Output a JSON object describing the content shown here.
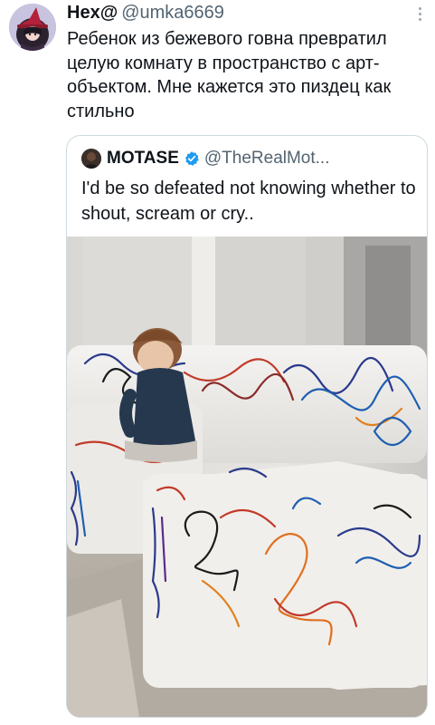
{
  "tweet": {
    "display_name": "Hex@",
    "handle": "@umka6669",
    "text": "Ребенок из бежевого говна превратил целую комнату в пространство с арт-объектом. Мне кажется это пиздец как стильно",
    "avatar_icon": "witch-avatar-icon",
    "more_icon": "more-options-icon"
  },
  "quote": {
    "display_name": "MOTASE",
    "handle": "@TheRealMot...",
    "verified_color": "#1d9bf0",
    "text": "I'd be so defeated not knowing whether to shout, scream or cry..",
    "media_icon": "photo-child-scribbled-sofa"
  },
  "colors": {
    "primary_text": "#0f1419",
    "secondary_text": "#536471",
    "border": "#cfd9de",
    "accent": "#1d9bf0"
  }
}
